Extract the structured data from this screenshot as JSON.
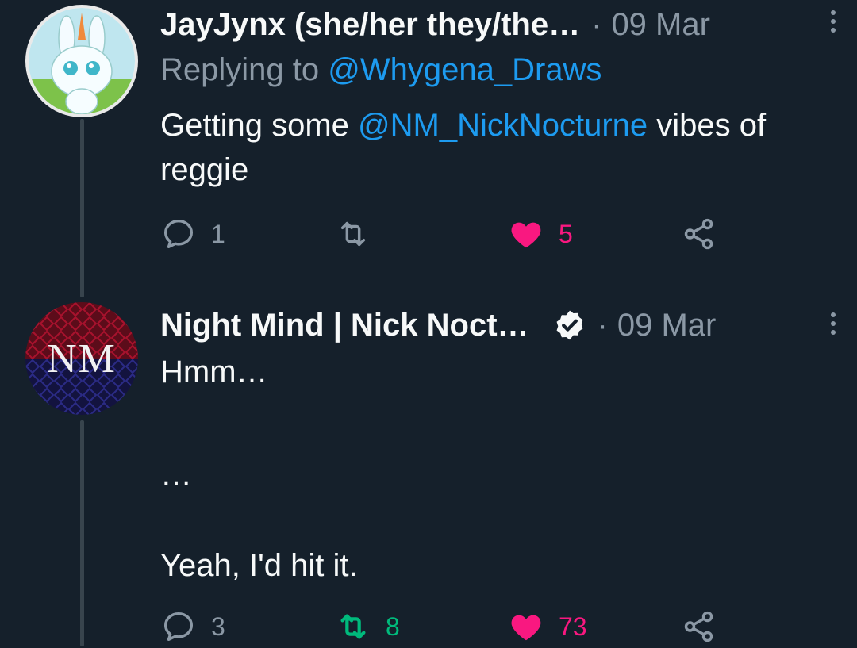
{
  "tweets": [
    {
      "display_name": "JayJynx (she/her they/the…",
      "separator": "·",
      "date": "09 Mar",
      "replying_label": "Replying to",
      "replying_handle": "@Whygena_Draws",
      "text_before": "Getting some",
      "mention": "@NM_NickNocturne",
      "text_after": "vibes of reggie",
      "reply_count": "1",
      "retweet_count": "",
      "like_count": "5"
    },
    {
      "display_name": "Night Mind | Nick Noct…",
      "avatar_text": "NM",
      "separator": "·",
      "date": "09 Mar",
      "line1": "Hmm…",
      "line2": "…",
      "line3": "Yeah, I'd hit it.",
      "reply_count": "3",
      "retweet_count": "8",
      "like_count": "73"
    }
  ],
  "colors": {
    "background": "#15202b",
    "link": "#1d9bf0",
    "muted": "#8b98a5",
    "like": "#f91880",
    "retweet": "#00ba7c"
  },
  "icons": [
    "reply-icon",
    "retweet-icon",
    "heart-icon",
    "share-icon",
    "more-icon",
    "verified-badge-icon"
  ]
}
